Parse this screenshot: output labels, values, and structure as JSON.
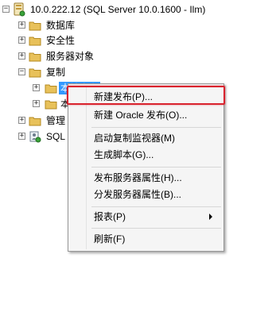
{
  "tree": {
    "server_label": "10.0.222.12 (SQL Server 10.0.1600 - Ilm)",
    "nodes": [
      {
        "label": "数据库",
        "expander": "+"
      },
      {
        "label": "安全性",
        "expander": "+"
      },
      {
        "label": "服务器对象",
        "expander": "+"
      },
      {
        "label": "复制",
        "expander": "−"
      },
      {
        "label": "管理",
        "expander": "+"
      },
      {
        "label": "SQL",
        "expander": "+"
      }
    ],
    "replication_children": [
      {
        "label": "本地发布",
        "expander": "+"
      },
      {
        "label": "本",
        "expander": "+"
      }
    ]
  },
  "context_menu": {
    "items": [
      {
        "label": "新建发布(P)..."
      },
      {
        "label": "新建 Oracle 发布(O)..."
      },
      {
        "label": "启动复制监视器(M)"
      },
      {
        "label": "生成脚本(G)..."
      },
      {
        "label": "发布服务器属性(H)..."
      },
      {
        "label": "分发服务器属性(B)..."
      },
      {
        "label": "报表(P)"
      },
      {
        "label": "刷新(F)"
      }
    ]
  },
  "colors": {
    "highlight": "#d9232e",
    "folder": "#e8c15a",
    "selection": "#3399ff"
  }
}
